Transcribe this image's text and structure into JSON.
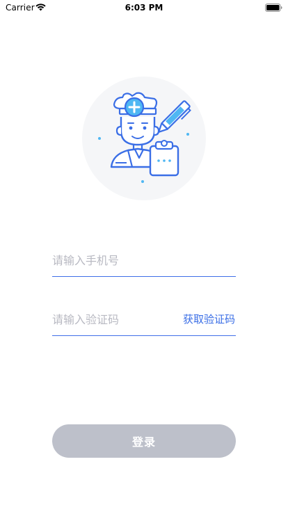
{
  "status_bar": {
    "carrier": "Carrier",
    "time": "6:03 PM"
  },
  "illustration": {
    "icon": "doctor-illustration-icon",
    "accent_color": "#3a6ee6",
    "light_accent_color": "#4fb7f3",
    "bg_circle_color": "#f5f6f8"
  },
  "form": {
    "phone_placeholder": "请输入手机号",
    "code_placeholder": "请输入验证码",
    "get_code_label": "获取验证码",
    "underline_color": "#3f6fe8"
  },
  "login": {
    "label": "登录",
    "bg_color": "#bdc0ca"
  }
}
